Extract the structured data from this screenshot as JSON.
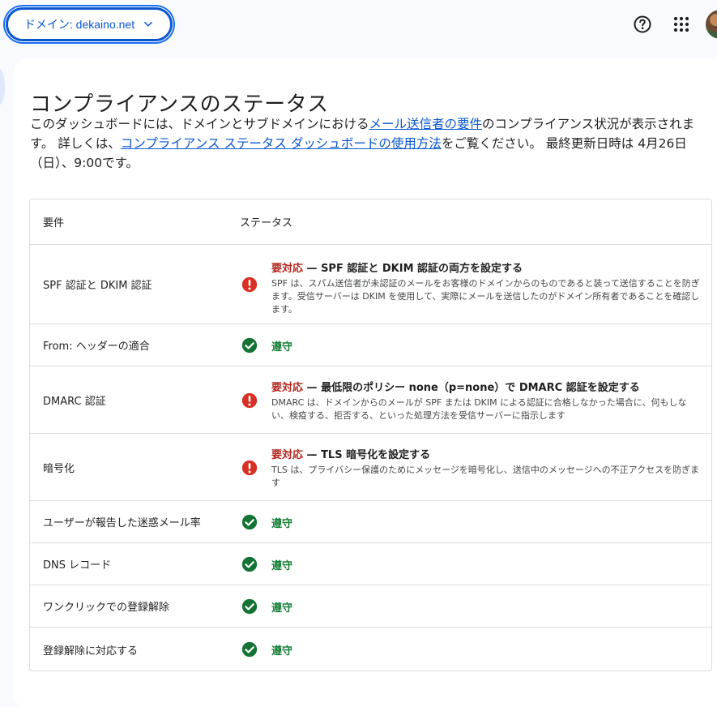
{
  "header": {
    "domain_label": "ドメイン: dekaino.net",
    "help_icon": "help-circle-icon",
    "apps_icon": "apps-grid-icon"
  },
  "page": {
    "title": "コンプライアンスのステータス",
    "desc_part1": "このダッシュボードには、ドメインとサブドメインにおける",
    "desc_link1": "メール送信者の要件",
    "desc_part2": "のコンプライアンス状況が表示されます。 詳しくは、",
    "desc_link2": "コンプライアンス ステータス ダッシュボードの使用方法",
    "desc_part3": "をご覧ください。 最終更新日時は 4月26日（日）、9:00です。"
  },
  "table": {
    "col_requirement": "要件",
    "col_status": "ステータス",
    "rows": [
      {
        "requirement": "SPF 認証と DKIM 認証",
        "state": "action",
        "action_label": "要対応",
        "title": " — SPF 認証と DKIM 認証の両方を設定する",
        "description": "SPF は、スパム送信者が未認証のメールをお客様のドメインからのものであると装って送信することを防ぎます。受信サーバーは DKIM を使用して、実際にメールを送信したのがドメイン所有者であることを確認します。"
      },
      {
        "requirement": "From: ヘッダーの適合",
        "state": "ok",
        "ok_label": "遵守"
      },
      {
        "requirement": "DMARC 認証",
        "state": "action",
        "action_label": "要対応",
        "title": " — 最低限のポリシー none（p=none）で DMARC 認証を設定する",
        "description": "DMARC は、ドメインからのメールが SPF または DKIM による認証に合格しなかった場合に、何もしない、検疫する、拒否する、といった処理方法を受信サーバーに指示します"
      },
      {
        "requirement": "暗号化",
        "state": "action",
        "action_label": "要対応",
        "title": " — TLS 暗号化を設定する",
        "description": "TLS は、プライバシー保護のためにメッセージを暗号化し、送信中のメッセージへの不正アクセスを防ぎます"
      },
      {
        "requirement": "ユーザーが報告した迷惑メール率",
        "state": "ok",
        "ok_label": "遵守"
      },
      {
        "requirement": "DNS レコード",
        "state": "ok",
        "ok_label": "遵守"
      },
      {
        "requirement": "ワンクリックでの登録解除",
        "state": "ok",
        "ok_label": "遵守"
      },
      {
        "requirement": "登録解除に対応する",
        "state": "ok",
        "ok_label": "遵守"
      }
    ]
  },
  "colors": {
    "accent": "#0b57d0",
    "action_red": "#b3261e",
    "error_icon": "#d93025",
    "ok_green": "#188038",
    "ok_icon": "#137333"
  }
}
